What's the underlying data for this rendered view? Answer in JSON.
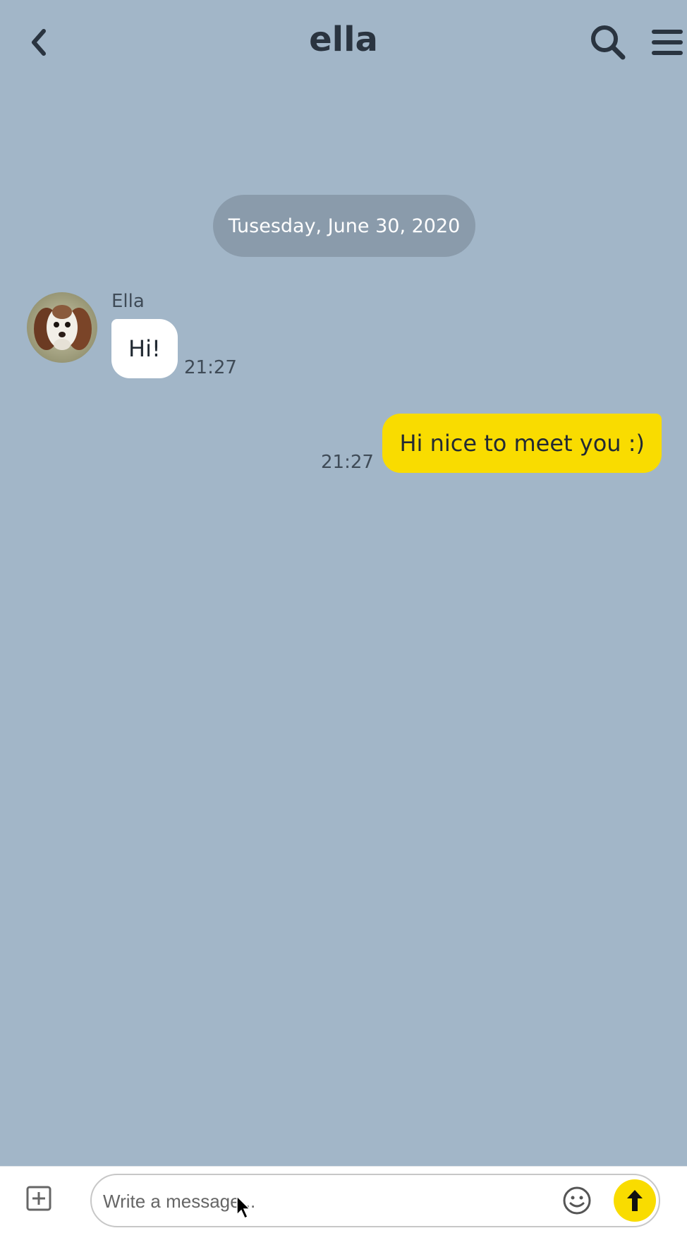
{
  "header": {
    "title": "ella",
    "back_icon": "chevron-left-icon",
    "search_icon": "search-icon",
    "menu_icon": "hamburger-menu-icon"
  },
  "chat": {
    "date_separator": "Tusesday, June 30, 2020",
    "messages": [
      {
        "direction": "incoming",
        "sender": "Ella",
        "text": "Hi!",
        "time": "21:27"
      },
      {
        "direction": "outgoing",
        "text": "Hi nice to meet you :)",
        "time": "21:27"
      }
    ]
  },
  "composer": {
    "placeholder": "Write a message...",
    "value": "",
    "attach_icon": "plus-square-icon",
    "emoji_icon": "smiley-icon",
    "send_icon": "arrow-up-icon"
  },
  "colors": {
    "background": "#a2b6c8",
    "outgoing_bubble": "#f9dc00",
    "incoming_bubble": "#ffffff",
    "date_pill": "#8a9bab",
    "send_button": "#f9dc00"
  }
}
